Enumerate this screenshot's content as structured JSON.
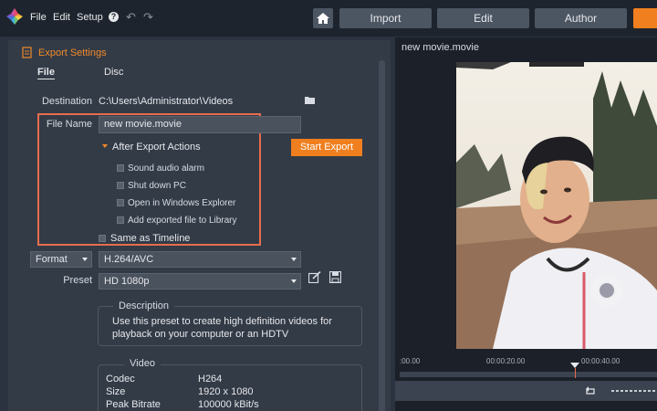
{
  "menu": {
    "file": "File",
    "edit": "Edit",
    "setup": "Setup",
    "help": "?"
  },
  "tabs": {
    "import": "Import",
    "edit": "Edit",
    "author": "Author"
  },
  "panel": {
    "title": "Export Settings",
    "subtabs": {
      "file": "File",
      "disc": "Disc"
    },
    "destination_label": "Destination",
    "destination_value": "C:\\Users\\Administrator\\Videos",
    "filename_label": "File Name",
    "filename_value": "new movie.movie",
    "start_export": "Start Export",
    "after_export_label": "After Export Actions",
    "after_export_actions": [
      {
        "label": "Sound audio alarm",
        "checked": false
      },
      {
        "label": "Shut down PC",
        "checked": false
      },
      {
        "label": "Open in Windows Explorer",
        "checked": false
      },
      {
        "label": "Add exported file to Library",
        "checked": false
      }
    ],
    "same_as_timeline": "Same as Timeline",
    "format_select": "Format",
    "format_value": "H.264/AVC",
    "preset_label": "Preset",
    "preset_value": "HD 1080p",
    "description_title": "Description",
    "description_text": "Use this preset to create high definition videos for playback on your computer or an HDTV",
    "video_title": "Video",
    "video_specs": [
      {
        "label": "Codec",
        "value": "H264"
      },
      {
        "label": "Size",
        "value": "1920 x 1080"
      },
      {
        "label": "Peak Bitrate",
        "value": "100000 kBit/s"
      }
    ]
  },
  "preview": {
    "title": "new movie.movie",
    "timeline_labels": [
      ":00.00",
      "00:00:20.00",
      "00:00:40.00"
    ],
    "playhead_position": 0.68
  },
  "colors": {
    "accent": "#f07f1f",
    "highlight": "#e86d4c",
    "panel": "#333b47"
  }
}
